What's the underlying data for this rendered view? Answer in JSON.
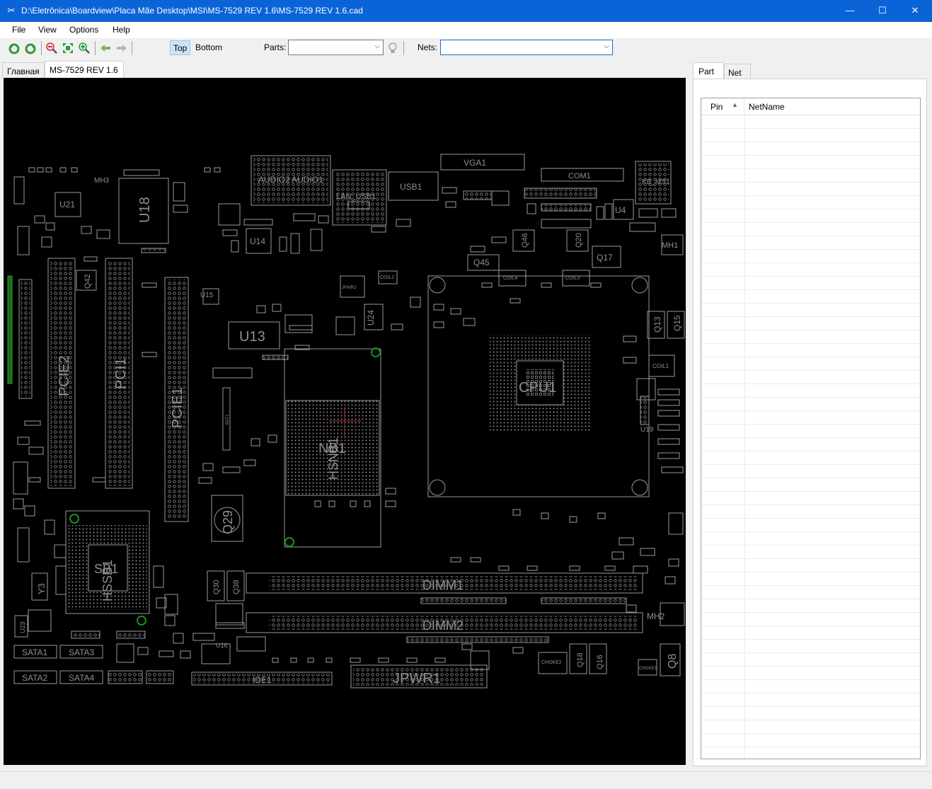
{
  "window": {
    "title": "D:\\Eletrônica\\Boardview\\Placa Mãe Desktop\\MSI\\MS-7529 REV 1.6\\MS-7529 REV 1.6.cad",
    "minimize_glyph": "—",
    "maximize_glyph": "☐",
    "close_glyph": "✕"
  },
  "menu": {
    "file": "File",
    "view": "View",
    "options": "Options",
    "help": "Help"
  },
  "toolbar": {
    "top_label": "Top",
    "bottom_label": "Bottom",
    "parts_label": "Parts:",
    "parts_value": "",
    "nets_label": "Nets:",
    "nets_value": "",
    "icons": [
      "rotate-left-icon",
      "rotate-right-icon",
      "zoom-out-icon",
      "fit-icon",
      "zoom-in-icon",
      "back-icon",
      "forward-icon",
      "search-bulb-icon"
    ]
  },
  "document_tabs": [
    {
      "label": "Главная",
      "active": false
    },
    {
      "label": "MS-7529 REV 1.6",
      "active": true
    }
  ],
  "right_panel": {
    "tabs": [
      {
        "label": "Part",
        "active": true
      },
      {
        "label": "Net",
        "active": false
      }
    ],
    "columns": [
      "Pin",
      "NetName"
    ]
  },
  "board": {
    "labels": [
      "U21",
      "U18",
      "MH3",
      "MH2",
      "MH1",
      "AUDIO2",
      "AUDIO1",
      "LAN_USB1",
      "USB1",
      "VGA1",
      "COM1",
      "KB_MS1",
      "U4",
      "U14",
      "U15",
      "U13",
      "U24",
      "Q45",
      "Q46",
      "Q20",
      "Q17",
      "Q42",
      "Q29",
      "Q30",
      "Q38",
      "Q18",
      "Q16",
      "Q8",
      "Q15",
      "Q13",
      "Y3",
      "U23",
      "U16",
      "CPU1",
      "NB1",
      "SB1",
      "DIMM1",
      "DIMM2",
      "JPWR1",
      "PCIE2",
      "PCI1",
      "PCIE1",
      "SATA1",
      "SATA2",
      "SATA3",
      "SATA4",
      "IDE1",
      "COIL1",
      "COIL2",
      "COIL3",
      "COIL4",
      "CHOKE2",
      "CHOKE3",
      "U19",
      "JPWR2",
      "HSNB1",
      "HSSB1",
      "BAT1"
    ]
  },
  "colors": {
    "titlebar": "#0a64d8",
    "board_bg": "#000000",
    "silkscreen": "#9a9a9a",
    "highlight_green": "#1e8e1e",
    "accent_button": "#cce4f7"
  }
}
